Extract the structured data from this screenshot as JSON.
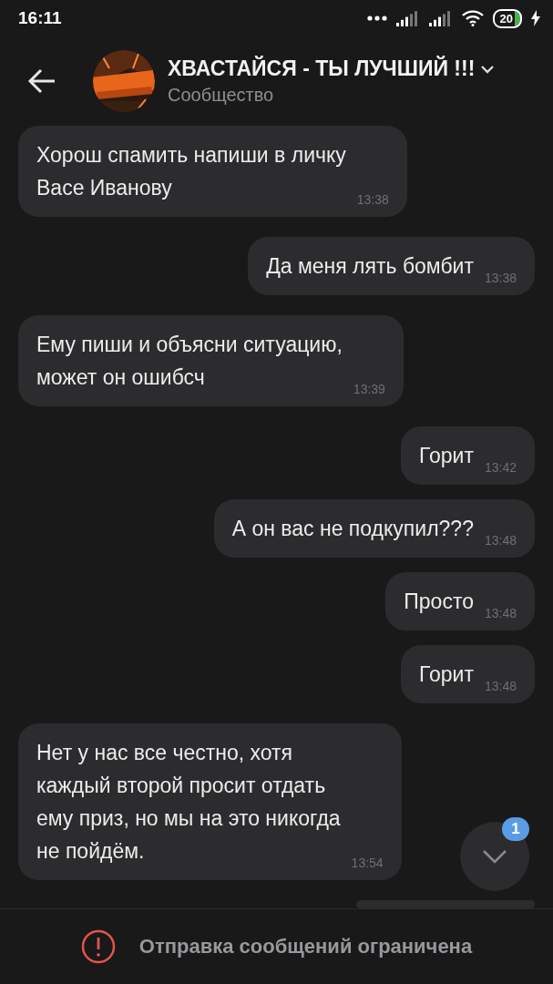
{
  "status_bar": {
    "time": "16:11",
    "battery": "20"
  },
  "header": {
    "title": "ХВАСТАЙСЯ - ТЫ ЛУЧШИЙ !!!",
    "subtitle": "Сообщество"
  },
  "messages": [
    {
      "kind": "incoming",
      "text": "Хорош спамить напиши в личку\nВасе Иванову",
      "time": "13:38"
    },
    {
      "kind": "outgoing",
      "text": "Да меня лять бомбит",
      "time": "13:38"
    },
    {
      "kind": "incoming",
      "text": "Ему пиши и объясни ситуацию,\nможет он ошибсч",
      "time": "13:39"
    },
    {
      "kind": "outgoing",
      "text": "Горит",
      "time": "13:42"
    },
    {
      "kind": "outgoing",
      "text": "А он вас не подкупил???",
      "time": "13:48"
    },
    {
      "kind": "outgoing",
      "text": "Просто",
      "time": "13:48"
    },
    {
      "kind": "outgoing",
      "text": "Горит",
      "time": "13:48"
    },
    {
      "kind": "incoming",
      "text": "Нет у нас все честно, хотя\nкаждый второй просит отдать\nему приз, но мы на это никогда\nне пойдём.",
      "time": "13:54"
    }
  ],
  "scroll_button": {
    "badge": "1"
  },
  "footer": {
    "notice": "Отправка сообщений ограничена"
  }
}
